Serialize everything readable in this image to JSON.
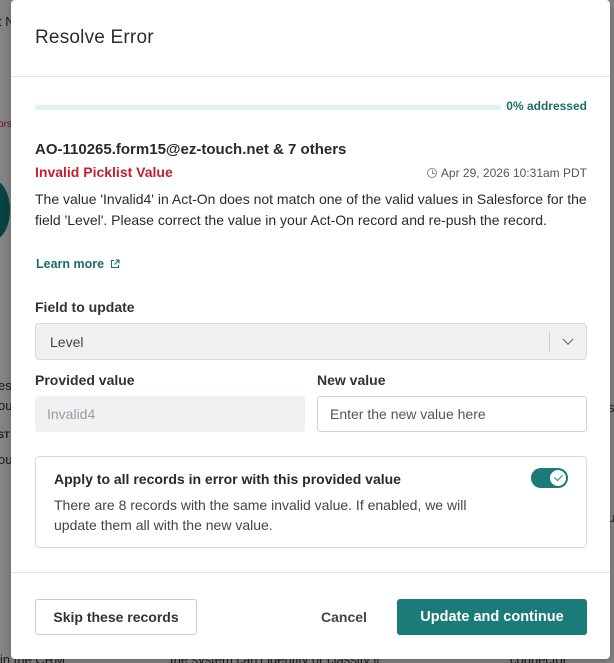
{
  "background": {
    "fragments": [
      "t N",
      "ors",
      "es",
      "ou",
      "ST",
      "ou",
      "s",
      "u",
      "in the CRM",
      "the system can't identify or classify it",
      "connector"
    ]
  },
  "modal": {
    "title": "Resolve Error",
    "progress": {
      "fraction": 0.0,
      "label": "0% addressed"
    },
    "record_email": "AO-110265.form15@ez-touch.net & 7 others",
    "error_title": "Invalid Picklist Value",
    "timestamp": "Apr 29, 2026 10:31am PDT",
    "description": "The value 'Invalid4' in Act-On does not match one of the valid values in Salesforce for the field 'Level'. Please correct the value in your Act-On record and re-push the record.",
    "learn_more": "Learn more",
    "field_to_update": {
      "label": "Field to update",
      "value": "Level"
    },
    "provided_value": {
      "label": "Provided value",
      "value": "Invalid4"
    },
    "new_value": {
      "label": "New value",
      "placeholder": "Enter the new value here",
      "value": ""
    },
    "apply_all": {
      "title": "Apply to all records in error with this provided value",
      "description": "There are 8 records with the same invalid value. If enabled, we will update them all with the new value.",
      "enabled": true
    },
    "footer": {
      "skip_label": "Skip these records",
      "cancel_label": "Cancel",
      "update_label": "Update and continue"
    }
  },
  "colors": {
    "accent": "#1a7b78",
    "error": "#c0202f",
    "progress_track": "#dff1f0"
  }
}
